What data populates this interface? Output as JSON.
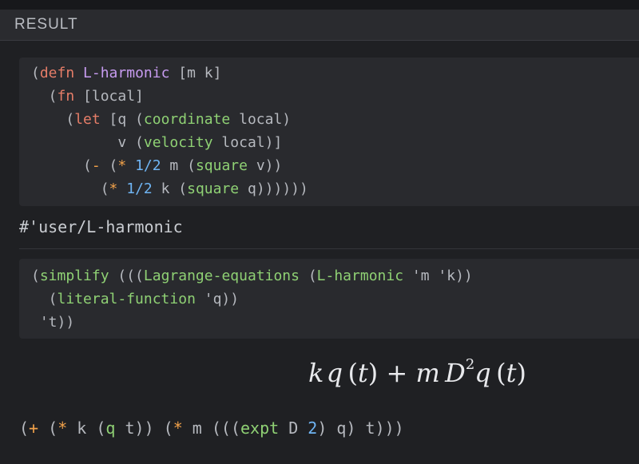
{
  "header": {
    "title": "RESULT"
  },
  "code1": {
    "lines": [
      [
        [
          "p",
          "("
        ],
        [
          "k",
          "defn"
        ],
        [
          "p",
          " "
        ],
        [
          "fnname",
          "L-harmonic"
        ],
        [
          "p",
          " [m k]"
        ]
      ],
      [
        [
          "p",
          "  ("
        ],
        [
          "k",
          "fn"
        ],
        [
          "p",
          " [local]"
        ]
      ],
      [
        [
          "p",
          "    ("
        ],
        [
          "k",
          "let"
        ],
        [
          "p",
          " [q ("
        ],
        [
          "call",
          "coordinate"
        ],
        [
          "p",
          " local)"
        ]
      ],
      [
        [
          "p",
          "          v ("
        ],
        [
          "call",
          "velocity"
        ],
        [
          "p",
          " local)]"
        ]
      ],
      [
        [
          "p",
          "      ("
        ],
        [
          "op",
          "-"
        ],
        [
          "p",
          " ("
        ],
        [
          "op",
          "*"
        ],
        [
          "p",
          " "
        ],
        [
          "num",
          "1/2"
        ],
        [
          "p",
          " m ("
        ],
        [
          "call",
          "square"
        ],
        [
          "p",
          " v))"
        ]
      ],
      [
        [
          "p",
          "        ("
        ],
        [
          "op",
          "*"
        ],
        [
          "p",
          " "
        ],
        [
          "num",
          "1/2"
        ],
        [
          "p",
          " k ("
        ],
        [
          "call",
          "square"
        ],
        [
          "p",
          " q))))))"
        ]
      ]
    ]
  },
  "result1": {
    "text": "#'user/L-harmonic"
  },
  "code2": {
    "lines": [
      [
        [
          "p",
          "("
        ],
        [
          "call",
          "simplify"
        ],
        [
          "p",
          " ((("
        ],
        [
          "call",
          "Lagrange-equations"
        ],
        [
          "p",
          " ("
        ],
        [
          "call",
          "L-harmonic"
        ],
        [
          "p",
          " 'm 'k))"
        ]
      ],
      [
        [
          "p",
          "  ("
        ],
        [
          "call",
          "literal-function"
        ],
        [
          "p",
          " 'q))"
        ]
      ],
      [
        [
          "p",
          " 't))"
        ]
      ]
    ]
  },
  "math": {
    "k": "k",
    "q": "q",
    "t": "t",
    "plus": "+",
    "m": "m",
    "D": "D",
    "exp": "2",
    "lp": "(",
    "rp": ")"
  },
  "result2": {
    "tokens": [
      [
        "p",
        "("
      ],
      [
        "op",
        "+"
      ],
      [
        "p",
        " ("
      ],
      [
        "op",
        "*"
      ],
      [
        "p",
        " k ("
      ],
      [
        "call",
        "q"
      ],
      [
        "p",
        " t)) ("
      ],
      [
        "op",
        "*"
      ],
      [
        "p",
        " m ((("
      ],
      [
        "call",
        "expt"
      ],
      [
        "p",
        " D "
      ],
      [
        "num",
        "2"
      ],
      [
        "p",
        ") q) t)))"
      ]
    ]
  }
}
